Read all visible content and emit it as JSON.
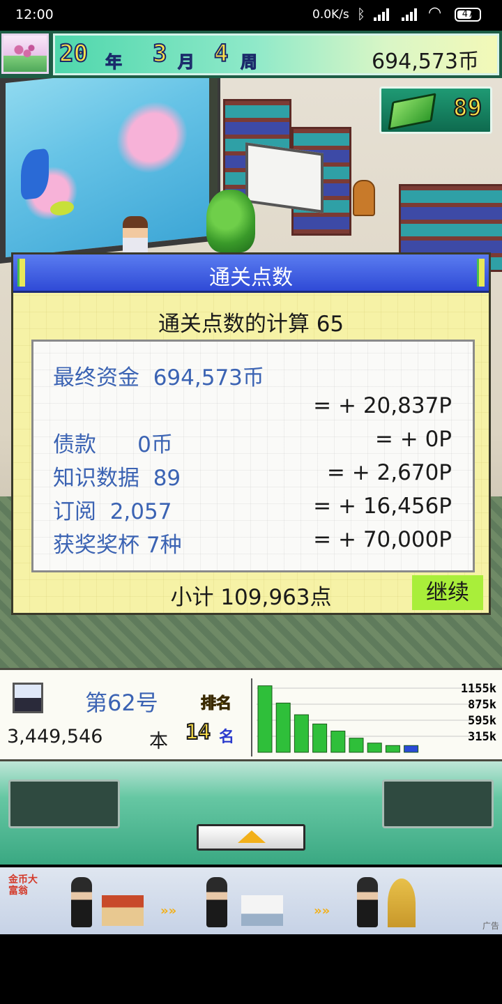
{
  "status_bar": {
    "time": "12:00",
    "network_speed": "0.0K/s",
    "battery": "47"
  },
  "top_bar": {
    "year": "20",
    "year_unit": "年",
    "month": "3",
    "month_unit": "月",
    "week": "4",
    "week_unit": "周",
    "money": "694,573币"
  },
  "knowledge_counter": {
    "value": "89",
    "icon": "book-icon"
  },
  "dialog": {
    "title": "通关点数",
    "calc_title": "通关点数的计算 65",
    "rows": [
      {
        "label": "最终资金  694,573币",
        "value": ""
      },
      {
        "label": "",
        "value": "= + 20,837P"
      },
      {
        "label": "债款      0币",
        "value": "= + 0P"
      },
      {
        "label": "知识数据  89",
        "value": "= + 2,670P"
      },
      {
        "label": "订阅  2,057",
        "value": "= + 16,456P"
      },
      {
        "label": "获奖奖杯 7种",
        "value": "= + 70,000P"
      }
    ],
    "subtotal": "小计 109,963点",
    "continue_label": "继续"
  },
  "info_panel": {
    "issue": "第62号",
    "rank_badge": "排名",
    "sales": "3,449,546",
    "sales_unit": "本",
    "rank": "14",
    "rank_suffix": "名"
  },
  "chart_data": {
    "type": "bar",
    "y_tick_labels": [
      "1155k",
      "875k",
      "595k",
      "315k"
    ],
    "ylim": [
      0,
      1155
    ],
    "values": [
      1080,
      800,
      610,
      460,
      345,
      230,
      150,
      110,
      110
    ],
    "colors": [
      "#2fbf3a",
      "#2fbf3a",
      "#2fbf3a",
      "#2fbf3a",
      "#2fbf3a",
      "#2fbf3a",
      "#2fbf3a",
      "#2fbf3a",
      "#2a4ad6"
    ]
  },
  "ad": {
    "logo": "金币大富翁",
    "tag": "广告"
  },
  "colors": {
    "accent_green": "#a9ee3a",
    "dialog_bg": "#f6f2a6",
    "label_blue": "#3b63b3",
    "header_blue": "#2f4ad6"
  }
}
